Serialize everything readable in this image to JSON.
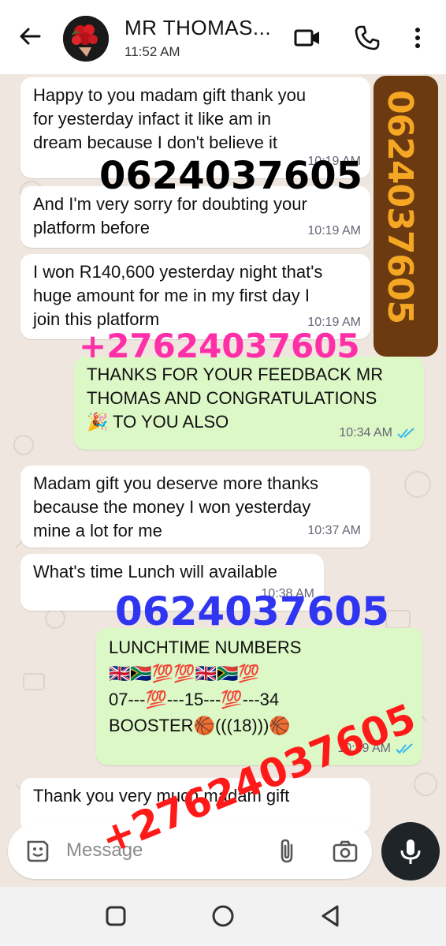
{
  "header": {
    "contact_name": "MR THOMAS...",
    "status": "11:52 AM",
    "icons": [
      "back-arrow-icon",
      "video-call-icon",
      "voice-call-icon",
      "more-options-icon"
    ]
  },
  "messages": [
    {
      "dir": "in",
      "text": "Happy to you madam gift thank you\nfor yesterday infact it like am in\ndream because I don't believe it",
      "time": "10:19 AM"
    },
    {
      "dir": "in",
      "text": "And I'm very sorry for doubting your\nplatform before",
      "time": "10:19 AM"
    },
    {
      "dir": "in",
      "text": "I won R140,600 yesterday night that's\nhuge amount for me in my first day I\njoin this platform",
      "time": "10:19 AM"
    },
    {
      "dir": "out",
      "text": "THANKS FOR YOUR FEEDBACK MR\nTHOMAS AND CONGRATULATIONS\n🎉 TO YOU ALSO",
      "time": "10:34 AM"
    },
    {
      "dir": "in",
      "text": "Madam gift you deserve more thanks\nbecause the money I won yesterday\nmine a lot for me",
      "time": "10:37 AM"
    },
    {
      "dir": "in",
      "text": "What's time Lunch will available",
      "time": "10:38 AM"
    },
    {
      "dir": "out",
      "text": "LUNCHTIME NUMBERS\n🇬🇧🇿🇦💯💯🇬🇧🇿🇦💯\n07---💯---15---💯---34\nBOOSTER🏀(((18)))🏀",
      "time": "10:49 AM"
    },
    {
      "dir": "in",
      "text": "Thank you very much madam gift",
      "time": ""
    }
  ],
  "watermarks": {
    "black": "0624037605",
    "vertical": "0624037605",
    "pink": "+27624037605",
    "blue": "0624037605",
    "red": "+27624037605"
  },
  "input": {
    "placeholder": "Message"
  },
  "colors": {
    "chat_bg": "#efe7df",
    "incoming_bubble": "#ffffff",
    "outgoing_bubble": "#dcf8c6",
    "read_ticks": "#34b7f1",
    "mic_button": "#1f2428"
  }
}
